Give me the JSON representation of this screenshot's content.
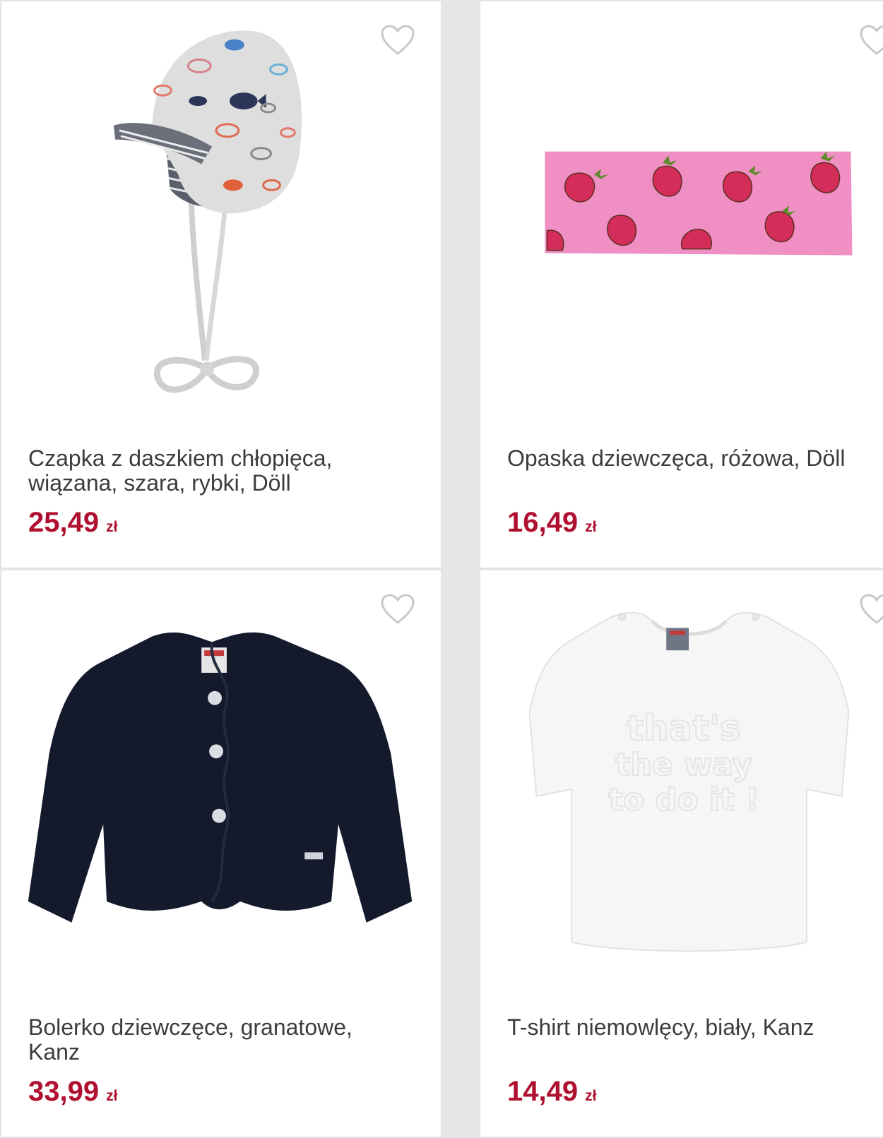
{
  "colors": {
    "price": "#b0102f",
    "title": "#3c3c3c",
    "heart_outline": "#c8c8c8",
    "background": "#e6e6e6"
  },
  "products": [
    {
      "title": "Czapka z daszkiem chłopięca, wiązana, szara, rybki, Döll",
      "price": "25,49",
      "currency": "zł",
      "favorite_icon": "heart-outline-icon"
    },
    {
      "title": "Opaska dziewczęca, różowa, Döll",
      "price": "16,49",
      "currency": "zł",
      "favorite_icon": "heart-outline-icon"
    },
    {
      "title": "Bolerko dziewczęce, granatowe, Kanz",
      "price": "33,99",
      "currency": "zł",
      "favorite_icon": "heart-outline-icon"
    },
    {
      "title": "T-shirt niemowlęcy, biały, Kanz",
      "price": "14,49",
      "currency": "zł",
      "favorite_icon": "heart-outline-icon"
    }
  ]
}
